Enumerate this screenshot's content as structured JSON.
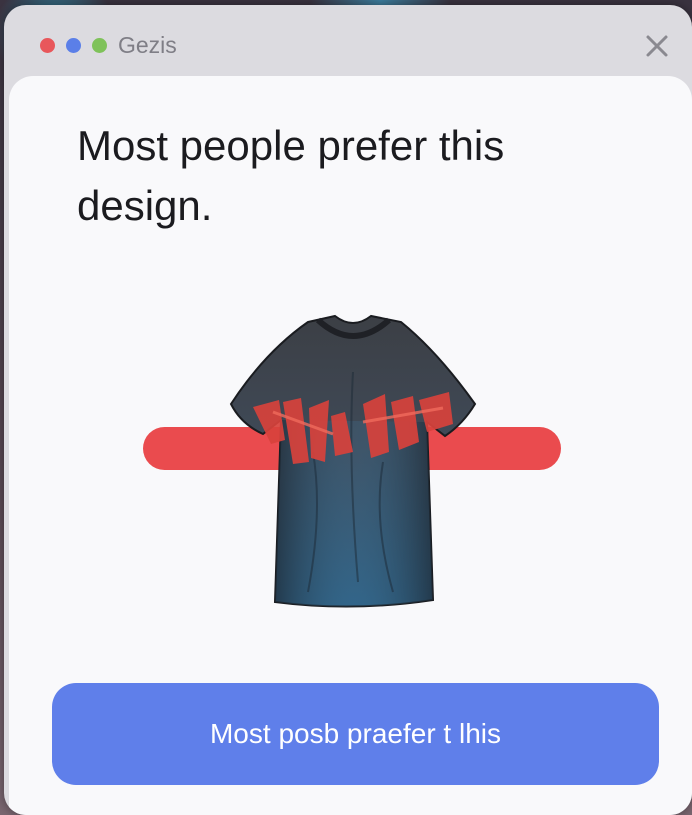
{
  "window": {
    "title": "Gezis",
    "close_icon": "close-icon",
    "traffic_lights": [
      "#e8575b",
      "#5b7fe8",
      "#7fc25a"
    ]
  },
  "main": {
    "headline": "Most people prefer this design.",
    "image_icon": "t-shirt-image",
    "slider_color": "#ea4b4e",
    "cta_label": "Most posb praefer t lhis",
    "cta_color": "#5f7fea"
  }
}
